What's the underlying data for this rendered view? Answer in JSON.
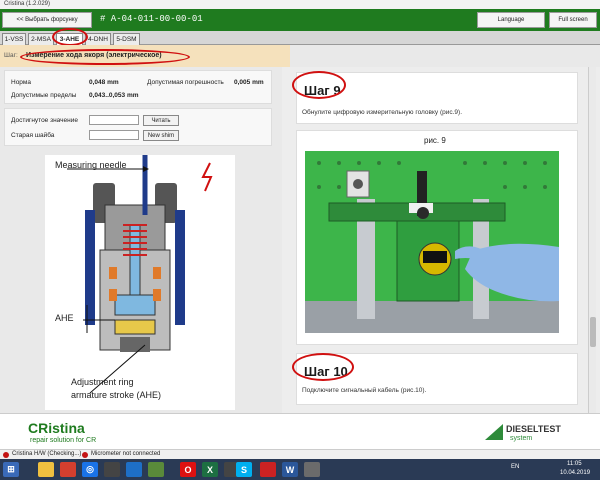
{
  "window": {
    "title": "Cristina (1.2.029)"
  },
  "header": {
    "back_label": "<< Выбрать форсунку",
    "part_code": "# A-04-011-00-00-01",
    "language_label": "Language",
    "fullscreen_label": "Full screen"
  },
  "tabs": [
    {
      "label": "1-VSS"
    },
    {
      "label": "2-MSA"
    },
    {
      "label": "3-AHE",
      "active": true
    },
    {
      "label": "4-DNH"
    },
    {
      "label": "5-DSM"
    }
  ],
  "step_bar": {
    "label": "Шаг:",
    "value": "Измерение хода якоря (электрическое)"
  },
  "params": {
    "norm_label": "Норма",
    "norm_value": "0,048 mm",
    "tolerance_label": "Допустимая погрешность",
    "tolerance_value": "0,005 mm",
    "limits_label": "Допустимые пределы",
    "limits_value": "0,043..0,053 mm"
  },
  "measure": {
    "reached_label": "Достигнутое значение",
    "read_button": "Читать",
    "old_shim_label": "Старая шайба",
    "new_shim_button": "New shim"
  },
  "diagram": {
    "needle_label": "Measuring needle",
    "ahe_label": "AHE",
    "ring_label_1": "Adjustment ring",
    "ring_label_2": "armature stroke (AHE)"
  },
  "steps": [
    {
      "title": "Шаг 9",
      "text": "Обнулите цифровую измерительную головку (рис.9).",
      "figure": "рис. 9"
    },
    {
      "title": "Шаг 10",
      "text": "Подключите сигнальный кабель (рис.10)."
    }
  ],
  "footer": {
    "brand": "CRistina",
    "tagline": "repair solution for CR",
    "partner_1": "DIESELTEST",
    "partner_2": "system"
  },
  "status": {
    "hw": "Cristina H/W (Checking...)",
    "micrometer": "Micrometer not connected"
  },
  "taskbar": {
    "lang": "EN",
    "time": "11:05",
    "date": "10.04.2019"
  },
  "colors": {
    "brand_green": "#1f7b1f",
    "highlight": "#d01010",
    "step_bg": "#f5e1bc"
  }
}
